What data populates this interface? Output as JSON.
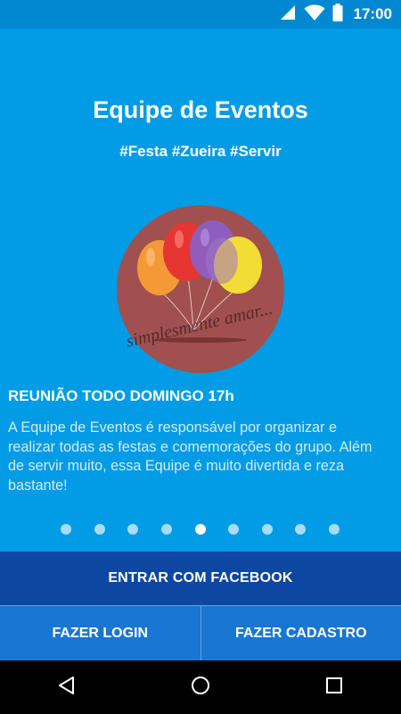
{
  "status_bar": {
    "time": "17:00",
    "icons": [
      "wifi-icon",
      "signal-icon",
      "battery-icon"
    ]
  },
  "slide": {
    "title": "Equipe de Eventos",
    "hashtags": "#Festa #Zueira #Servir",
    "logo_caption": "simplesmente amar...",
    "meeting": "REUNIÃO TODO DOMINGO 17h",
    "description": "A Equipe de Eventos é responsável por organizar e realizar todas as festas e comemorações do grupo. Além de servir muito, essa Equipe é muito divertida e reza bastante!"
  },
  "pagination": {
    "total": 9,
    "active_index": 4
  },
  "actions": {
    "facebook": "ENTRAR COM FACEBOOK",
    "login": "FAZER LOGIN",
    "signup": "FAZER CADASTRO"
  },
  "navigation": {
    "icons": [
      "back-icon",
      "home-icon",
      "recents-icon"
    ]
  },
  "colors": {
    "background": "#029be5",
    "status_bar": "#0288d1",
    "facebook_button": "#0d47a1",
    "secondary_buttons": "#1976d2",
    "logo_circle": "#a0504e"
  }
}
